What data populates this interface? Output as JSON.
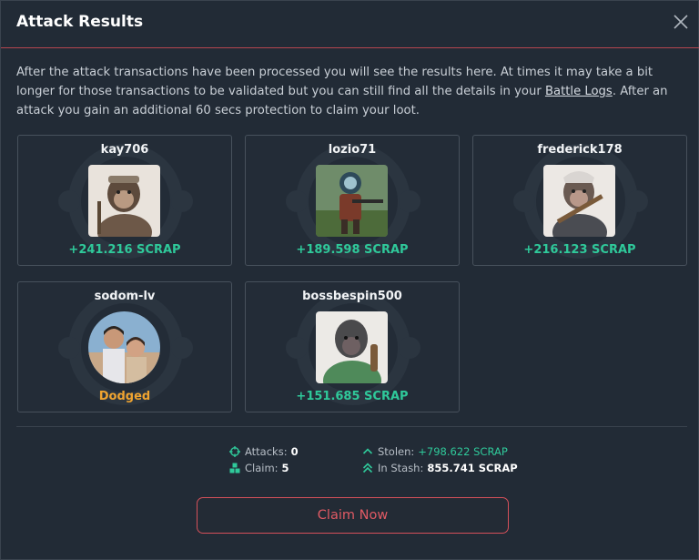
{
  "modal": {
    "title": "Attack Results",
    "close_icon": "close-icon"
  },
  "intro": {
    "text_before": "After the attack transactions have been processed you will see the results here. At times it may take a bit longer for those transactions to be validated but you can still find all the details in your ",
    "link": "Battle Logs",
    "text_after": ". After an attack you gain an additional 60 secs protection to claim your loot."
  },
  "results": [
    {
      "name": "kay706",
      "result": "+241.216 SCRAP",
      "status": "success",
      "avatar": "monkey-explorer"
    },
    {
      "name": "lozio71",
      "result": "+189.598 SCRAP",
      "status": "success",
      "avatar": "astronaut-soldier"
    },
    {
      "name": "frederick178",
      "result": "+216.123 SCRAP",
      "status": "success",
      "avatar": "monkey-warrior"
    },
    {
      "name": "sodom-lv",
      "result": "Dodged",
      "status": "dodged",
      "avatar": "photo-couple"
    },
    {
      "name": "bossbespin500",
      "result": "+151.685 SCRAP",
      "status": "success",
      "avatar": "monkey-green-jacket"
    }
  ],
  "stats": {
    "attacks_label": "Attacks:",
    "attacks_value": "0",
    "claim_label": "Claim:",
    "claim_value": "5",
    "stolen_label": "Stolen:",
    "stolen_value": "+798.622 SCRAP",
    "stash_label": "In Stash:",
    "stash_value": "855.741 SCRAP"
  },
  "claim_button": "Claim Now",
  "colors": {
    "accent": "#d5505a",
    "success": "#2fc99a",
    "dodged": "#f0a430",
    "background": "#222b36"
  }
}
